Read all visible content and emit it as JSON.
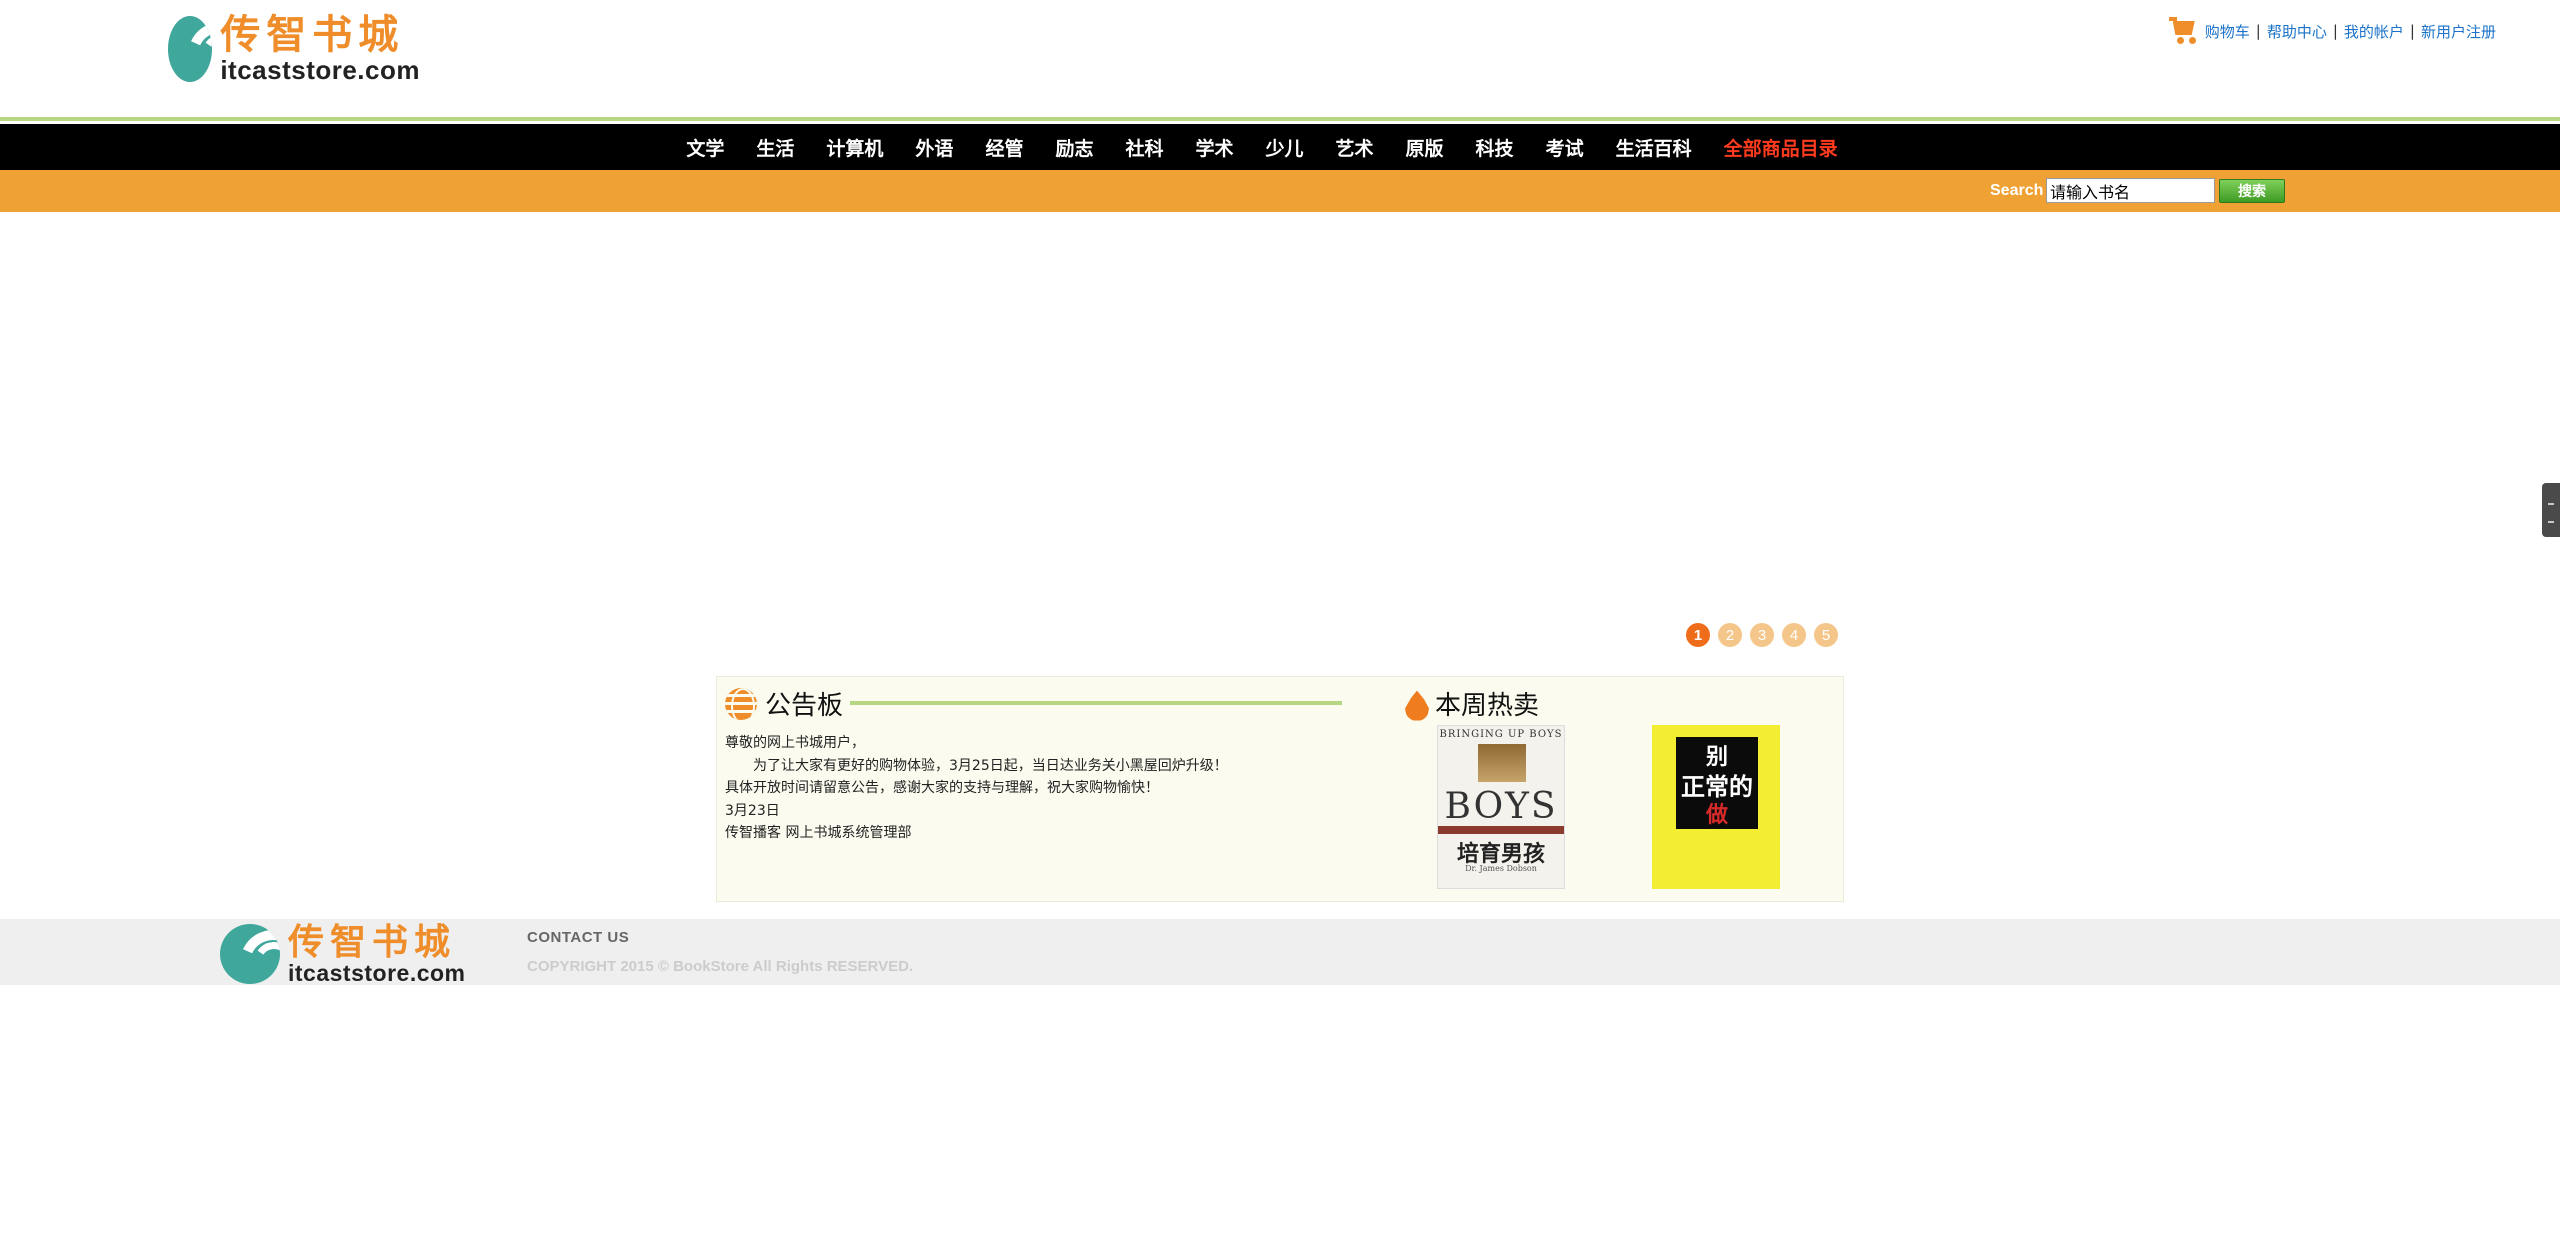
{
  "header": {
    "logo_cn": "传智书城",
    "logo_en": "itcaststore.com",
    "links": [
      "购物车",
      "帮助中心",
      "我的帐户",
      "新用户注册"
    ],
    "separator": "|"
  },
  "nav": {
    "items": [
      "文学",
      "生活",
      "计算机",
      "外语",
      "经管",
      "励志",
      "社科",
      "学术",
      "少儿",
      "艺术",
      "原版",
      "科技",
      "考试",
      "生活百科"
    ],
    "all_label": "全部商品目录"
  },
  "search": {
    "label": "Search",
    "value": "请输入书名",
    "button": "搜索"
  },
  "carousel": {
    "pages": [
      "1",
      "2",
      "3",
      "4",
      "5"
    ],
    "active_page": "1"
  },
  "notice": {
    "title": "公告板",
    "lines": [
      "尊敬的网上书城用户，",
      "为了让大家有更好的购物体验，3月25日起，当日达业务关小黑屋回炉升级！",
      "具体开放时间请留意公告，感谢大家的支持与理解，祝大家购物愉快！",
      "3月23日",
      "传智播客 网上书城系统管理部"
    ]
  },
  "hot": {
    "title": "本周热卖",
    "books": [
      {
        "top": "BRINGING UP BOYS",
        "big": "BOYS",
        "cn": "培育男孩",
        "author": "Dr. James Dobson"
      },
      {
        "t1": "别",
        "t2": "正常的",
        "t3": "做"
      }
    ]
  },
  "footer": {
    "contact": "CONTACT US",
    "copyright": "COPYRIGHT 2015 © BookStore All Rights RESERVED."
  },
  "colors": {
    "brand_orange": "#ef8d2b",
    "search_bar": "#efa233",
    "nav_bg": "#000000",
    "all_goods_red": "#ff3b1f",
    "accent_green": "#b7d681",
    "link_blue": "#1a73c8"
  }
}
